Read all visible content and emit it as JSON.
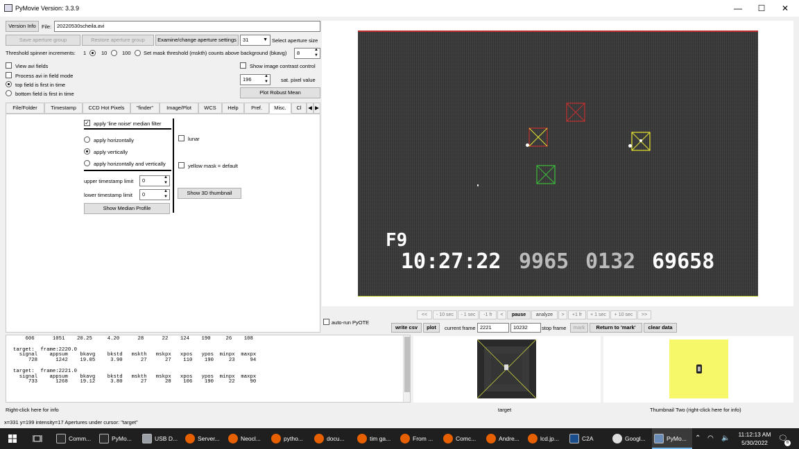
{
  "window": {
    "title": "PyMovie  Version: 3.3.9",
    "controls": [
      "—",
      "☐",
      "✕"
    ]
  },
  "top": {
    "version_info_btn": "Version Info",
    "file_label": "File:",
    "file_value": "20220530scheila.avi",
    "save_aperture_group": "Save aperture group",
    "restore_aperture_group": "Restore aperture group",
    "examine_aperture_settings": "Examine/change aperture settings",
    "aperture_size_value": "31",
    "select_aperture_size": "Select aperture size",
    "threshold_label": "Threshold spinner increments:",
    "inc_1": "1",
    "inc_10": "10",
    "inc_100": "100",
    "mask_threshold_label": "Set mask threshold (mskth) counts above background (bkavg)",
    "mask_threshold_value": "8",
    "view_avi_fields": "View avi fields",
    "process_field_mode": "Process avi in field mode",
    "top_field_first": "top field is first in time",
    "bottom_field_first": "bottom field is first in time",
    "show_contrast": "Show image contrast control",
    "sat_pixel_value": "196",
    "sat_pixel_label": "sat. pixel value",
    "plot_robust_mean": "Plot Robust Mean"
  },
  "tabs": [
    "File/Folder",
    "Timestamp",
    "CCD Hot Pixels",
    "\"finder\"",
    "Image/Plot",
    "WCS",
    "Help",
    "Pref.",
    "Misc.",
    "Cl"
  ],
  "misc": {
    "line_noise_filter": "apply 'line noise' median filter",
    "apply_horizontally": "apply horizontally",
    "apply_vertically": "apply vertically",
    "apply_both": "apply horizontally and vertically",
    "upper_ts_label": "upper timestamp limit",
    "upper_ts_value": "0",
    "lower_ts_label": "lower timestamp limit",
    "lower_ts_value": "0",
    "show_median_profile": "Show Median Profile",
    "lunar": "lunar",
    "yellow_mask": "yellow mask = default",
    "show_3d_thumbnail": "Show 3D thumbnail"
  },
  "video_overlay": {
    "field": "F9",
    "timestamp": "10:27:22",
    "num1": "9965",
    "num2": "0132",
    "num3": "69658"
  },
  "playback": {
    "buttons": [
      "<<",
      "- 10 sec",
      "- 1 sec",
      "-1 fr",
      "<",
      "pause",
      "analyze",
      ">",
      "+1 fr",
      "+ 1 sec",
      "+ 10 sec",
      ">>"
    ],
    "autorun_pyote": "auto-run PyOTE",
    "write_csv": "write csv",
    "plot": "plot",
    "current_frame_label": "current frame",
    "current_frame_value": "2221",
    "stop_frame_value": "10232",
    "stop_frame_label": "stop frame",
    "mark": "mark",
    "return_to_mark": "Return to 'mark'",
    "clear_data": "clear data"
  },
  "output_text": "    606      1051    20.25     4.20      28      22    124    190     26    108\n\ntarget:  frame:2220.0\n  signal    appsum    bkavg    bkstd   mskth   mskpx   xpos   ypos  minpx  maxpx\n     728      1242    19.05     3.90      27      27    110    190     23     94\n\ntarget:  frame:2221.0\n  signal    appsum    bkavg    bkstd   mskth   mskpx   xpos   ypos  minpx  maxpx\n     733      1268    19.12     3.80      27      28    106    190     22     90",
  "right_click_info": "Right-click here for info",
  "thumb1_caption": "target",
  "thumb2_caption": "Thumbnail Two (right-click here for info)",
  "status_bar": "x=331 y=199 intensity=17   Apertures under cursor: \"target\"",
  "taskbar": {
    "items": [
      {
        "label": "Comm...",
        "icon": "terminal-icon"
      },
      {
        "label": "PyMo...",
        "icon": "terminal-icon"
      },
      {
        "label": "USB D...",
        "icon": "usb-drive-icon"
      },
      {
        "label": "Server...",
        "icon": "firefox-icon"
      },
      {
        "label": "Neocl...",
        "icon": "firefox-icon"
      },
      {
        "label": "pytho...",
        "icon": "firefox-icon"
      },
      {
        "label": "docu...",
        "icon": "firefox-icon"
      },
      {
        "label": "tim ga...",
        "icon": "firefox-icon"
      },
      {
        "label": "From ...",
        "icon": "firefox-icon"
      },
      {
        "label": "Comc...",
        "icon": "firefox-icon"
      },
      {
        "label": "Andre...",
        "icon": "firefox-icon"
      },
      {
        "label": "lcd.jp...",
        "icon": "firefox-icon"
      },
      {
        "label": "C2A",
        "icon": "c2a-icon"
      },
      {
        "label": "Googl...",
        "icon": "chrome-icon"
      },
      {
        "label": "PyMo...",
        "icon": "pymovie-icon"
      }
    ],
    "time": "11:12:13 AM",
    "date": "5/30/2022",
    "notification_count": "6"
  },
  "colors": {
    "accent_blue": "#76b9ed",
    "aperture_red": "#c43030",
    "aperture_green": "#3bbf3b",
    "aperture_yellow": "#e8e830",
    "firefox": "#e66000"
  }
}
